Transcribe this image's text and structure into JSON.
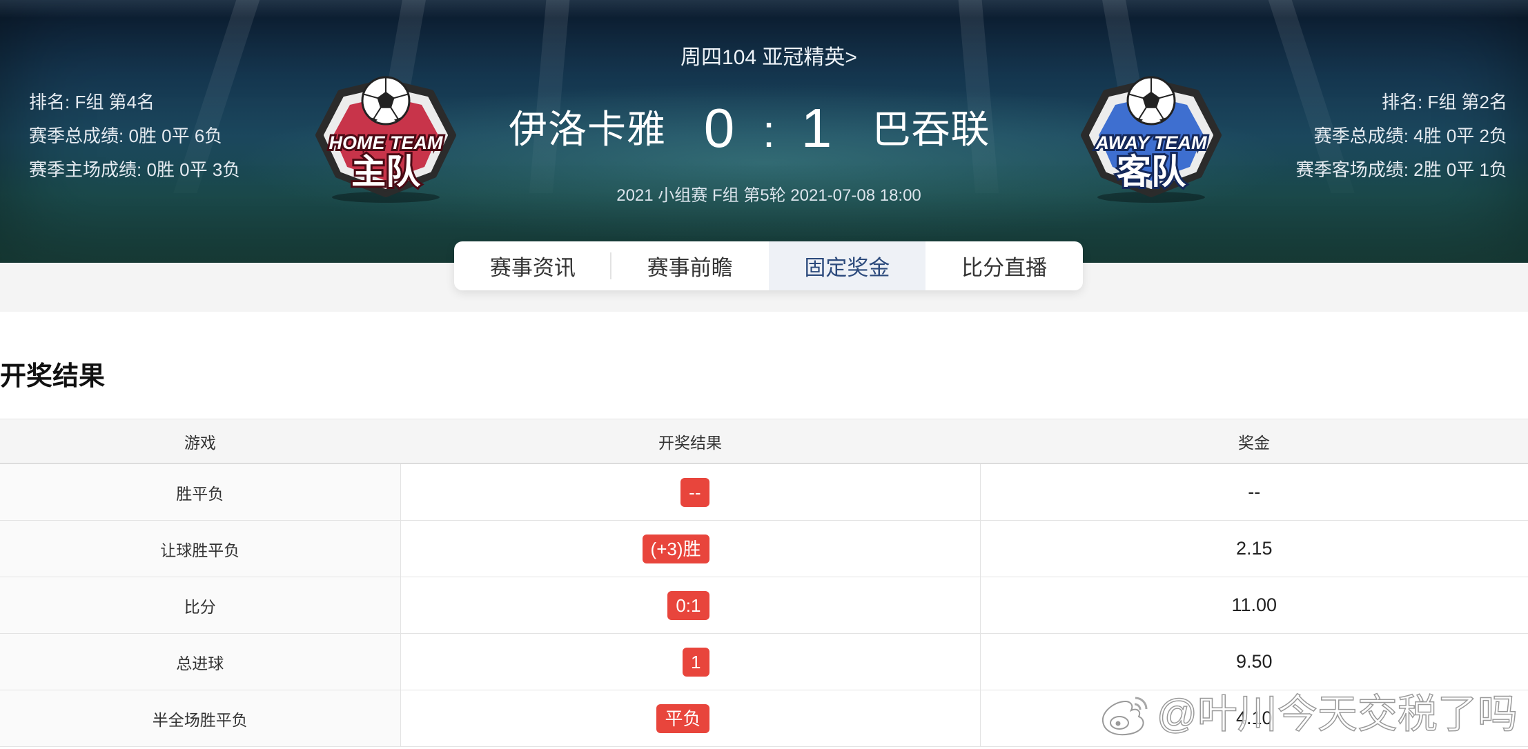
{
  "match": {
    "header_link": "周四104 亚冠精英>",
    "info": "2021 小组赛 F组 第5轮 2021-07-08 18:00",
    "score_home": "0",
    "score_sep": ":",
    "score_away": "1",
    "home": {
      "name": "伊洛卡雅",
      "badge_top": "HOME TEAM",
      "badge_bottom": "主队",
      "stats": [
        "排名: F组 第4名",
        "赛季总成绩: 0胜 0平 6负",
        "赛季主场成绩: 0胜 0平 3负"
      ]
    },
    "away": {
      "name": "巴吞联",
      "badge_top": "AWAY TEAM",
      "badge_bottom": "客队",
      "stats": [
        "排名: F组 第2名",
        "赛季总成绩: 4胜 0平 2负",
        "赛季客场成绩: 2胜 0平 1负"
      ]
    }
  },
  "tabs": [
    {
      "label": "赛事资讯",
      "active": false
    },
    {
      "label": "赛事前瞻",
      "active": false
    },
    {
      "label": "固定奖金",
      "active": true
    },
    {
      "label": "比分直播",
      "active": false
    }
  ],
  "results": {
    "title": "开奖结果",
    "columns": [
      "游戏",
      "开奖结果",
      "奖金"
    ],
    "rows": [
      {
        "game": "胜平负",
        "result": "--",
        "prize": "--"
      },
      {
        "game": "让球胜平负",
        "result": "(+3)胜",
        "prize": "2.15"
      },
      {
        "game": "比分",
        "result": "0:1",
        "prize": "11.00"
      },
      {
        "game": "总进球",
        "result": "1",
        "prize": "9.50"
      },
      {
        "game": "半全场胜平负",
        "result": "平负",
        "prize": "4.10"
      }
    ]
  },
  "watermark": {
    "text": "@叶川今天交税了吗",
    "icon": "weibo-icon"
  },
  "colors": {
    "badge_red": "#e8453c",
    "active_tab_bg": "#eef1f6",
    "active_tab_text": "#2c4a7c",
    "home_badge": "#c8344a",
    "away_badge": "#3e6fd0"
  }
}
